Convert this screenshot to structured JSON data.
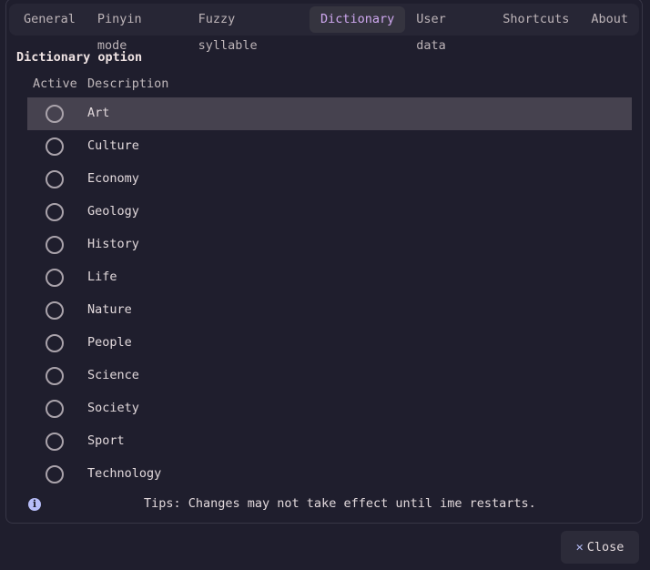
{
  "tabs": [
    {
      "label": "General"
    },
    {
      "label": "Pinyin mode"
    },
    {
      "label": "Fuzzy syllable"
    },
    {
      "label": "Dictionary",
      "active": true
    },
    {
      "label": "User data"
    },
    {
      "label": "Shortcuts"
    },
    {
      "label": "About"
    }
  ],
  "section_title": "Dictionary option",
  "columns": {
    "active": "Active",
    "description": "Description"
  },
  "rows": [
    {
      "label": "Art",
      "active": false,
      "selected": true
    },
    {
      "label": "Culture",
      "active": false
    },
    {
      "label": "Economy",
      "active": false
    },
    {
      "label": "Geology",
      "active": false
    },
    {
      "label": "History",
      "active": false
    },
    {
      "label": "Life",
      "active": false
    },
    {
      "label": "Nature",
      "active": false
    },
    {
      "label": "People",
      "active": false
    },
    {
      "label": "Science",
      "active": false
    },
    {
      "label": "Society",
      "active": false
    },
    {
      "label": "Sport",
      "active": false
    },
    {
      "label": "Technology",
      "active": false
    }
  ],
  "tip": "Tips: Changes may not take effect until ime restarts.",
  "info_icon": "i",
  "close": {
    "icon": "✕",
    "label": "Close"
  },
  "colors": {
    "accent": "#cfa8f0",
    "background": "#1f1e2d",
    "selected_row": "#46424f",
    "info": "#b7bdf8"
  }
}
